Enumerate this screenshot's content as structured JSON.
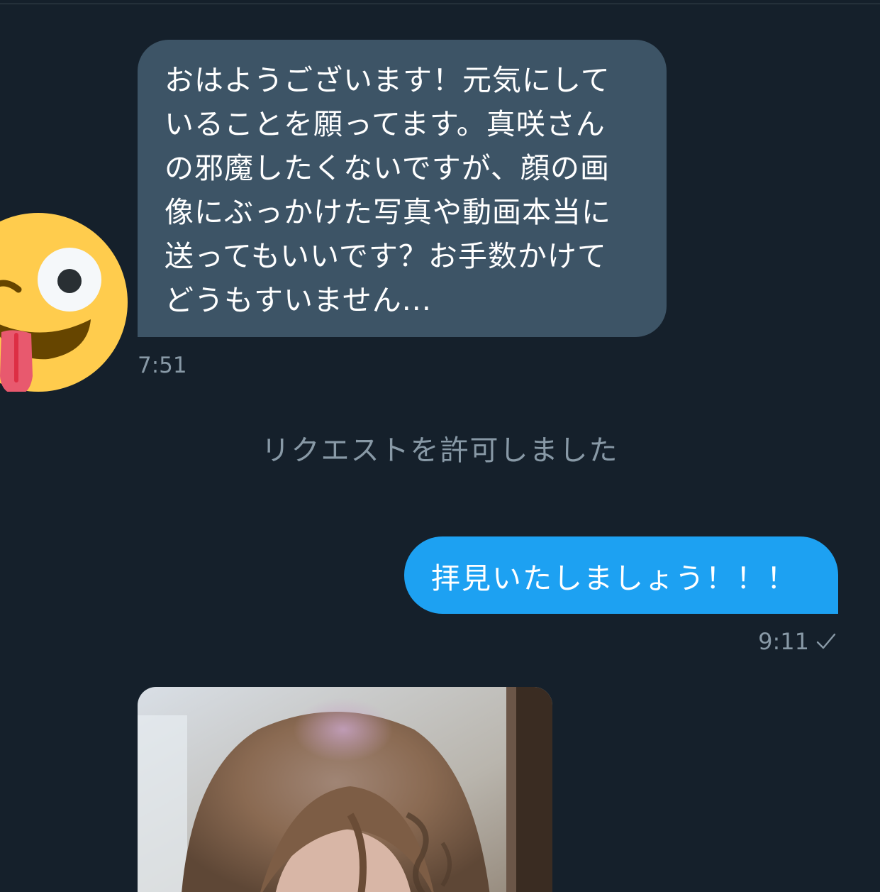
{
  "conversation": {
    "incoming": {
      "avatar_icon": "winking-face-with-tongue-emoji",
      "lines": [
        "おはようございます！元気にして",
        "いることを願ってます。真咲さん",
        "の邪魔したくないですが、顔の画",
        "像にぶっかけた写真や動画本当に",
        "送ってもいいです？お手数かけて",
        "どうもすいません..."
      ],
      "time": "7:51"
    },
    "system_notice": "リクエストを許可しました",
    "outgoing": {
      "text": "拝見いたしましょう！！！",
      "time": "9:11",
      "status_icon": "sent-check-icon"
    },
    "photo_message": {
      "icon": "photo-attachment"
    }
  },
  "colors": {
    "background": "#15202b",
    "incoming_bubble": "#3d5466",
    "outgoing_bubble": "#1da1f2",
    "meta_text": "#8899a6"
  }
}
